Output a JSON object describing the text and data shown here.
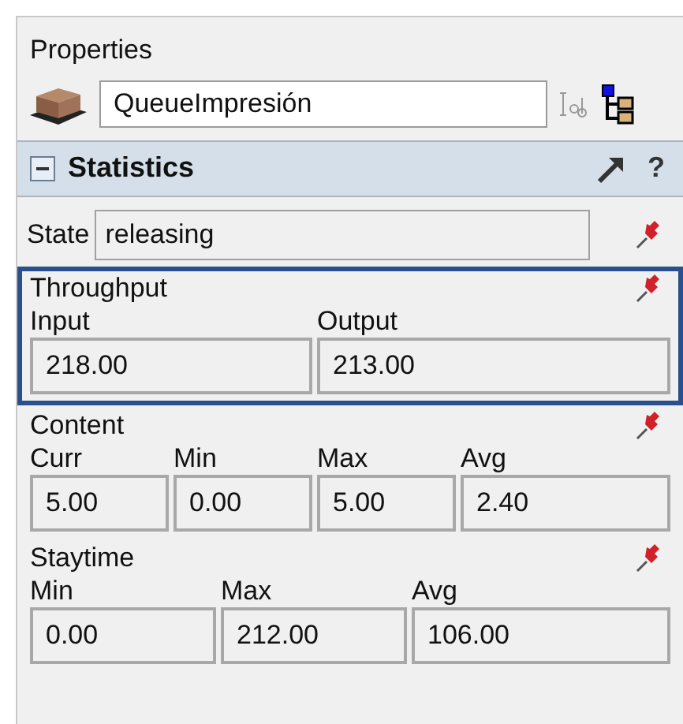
{
  "panel": {
    "title": "Properties"
  },
  "object": {
    "name": "QueueImpresión"
  },
  "section": {
    "title": "Statistics",
    "expanded": true,
    "help": "?"
  },
  "state": {
    "label": "State",
    "value": "releasing"
  },
  "groups": [
    {
      "title": "Throughput",
      "highlighted": true,
      "fields": [
        {
          "label": "Input",
          "value": "218.00"
        },
        {
          "label": "Output",
          "value": "213.00"
        }
      ]
    },
    {
      "title": "Content",
      "highlighted": false,
      "fields": [
        {
          "label": "Curr",
          "value": "5.00"
        },
        {
          "label": "Min",
          "value": "0.00"
        },
        {
          "label": "Max",
          "value": "5.00"
        },
        {
          "label": "Avg",
          "value": "2.40"
        }
      ]
    },
    {
      "title": "Staytime",
      "highlighted": false,
      "fields": [
        {
          "label": "Min",
          "value": "0.00"
        },
        {
          "label": "Max",
          "value": "212.00"
        },
        {
          "label": "Avg",
          "value": "106.00"
        }
      ]
    }
  ]
}
